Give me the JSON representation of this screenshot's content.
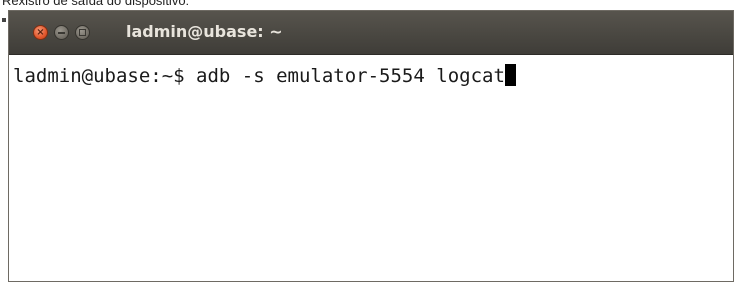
{
  "caption": "Rexistro de saída do dispositivo:",
  "window": {
    "title": "ladmin@ubase: ~",
    "buttons": {
      "close_icon": "close-icon",
      "minimize_icon": "minimize-icon",
      "maximize_icon": "maximize-icon"
    }
  },
  "terminal": {
    "prompt": "ladmin@ubase:~$ ",
    "command": "adb -s emulator-5554 logcat"
  },
  "colors": {
    "titlebar": "#4a4842",
    "close_button": "#e2572c",
    "title_text": "#e8e4dc",
    "terminal_background": "#ffffff",
    "terminal_text": "#1a1a1a"
  }
}
